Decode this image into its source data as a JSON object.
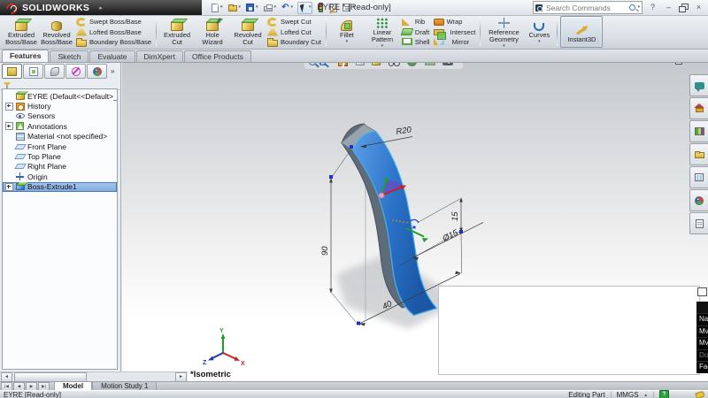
{
  "window": {
    "brand": "SOLIDWORKS",
    "title": "EYRE * [Read-only]",
    "search_placeholder": "Search Commands"
  },
  "glyphs": {
    "caret": "▾",
    "chevrons": "»",
    "minimize": "–",
    "close": "×",
    "help": "?",
    "undo": "↶",
    "overflow": "▸",
    "scroll_left": "◄",
    "scroll_right": "►",
    "nav_first": "|◀",
    "nav_prev": "◀",
    "nav_next": "▶",
    "nav_last": "▶|",
    "up_caret": "▲"
  },
  "quick_access_icons": [
    "new",
    "open",
    "save",
    "print",
    "undo",
    "select",
    "rebuild",
    "file-properties",
    "options"
  ],
  "command_tabs": {
    "active": "Features",
    "items": [
      "Features",
      "Sketch",
      "Evaluate",
      "DimXpert",
      "Office Products"
    ]
  },
  "ribbon": {
    "groups": [
      {
        "big": [
          {
            "label": "Extruded\nBoss/Base"
          },
          {
            "label": "Revolved\nBoss/Base"
          }
        ],
        "small": [
          {
            "label": "Swept Boss/Base"
          },
          {
            "label": "Lofted Boss/Base"
          },
          {
            "label": "Boundary Boss/Base"
          }
        ]
      },
      {
        "big": [
          {
            "label": "Extruded\nCut"
          },
          {
            "label": "Hole\nWizard"
          },
          {
            "label": "Revolved\nCut"
          }
        ],
        "small": [
          {
            "label": "Swept Cut"
          },
          {
            "label": "Lofted Cut"
          },
          {
            "label": "Boundary Cut"
          }
        ]
      },
      {
        "big": [
          {
            "label": "Fillet"
          },
          {
            "label": "Linear\nPattern"
          }
        ],
        "small": [
          {
            "label": "Rib"
          },
          {
            "label": "Draft"
          },
          {
            "label": "Shell"
          }
        ],
        "small2": [
          {
            "label": "Wrap"
          },
          {
            "label": "Intersect"
          },
          {
            "label": "Mirror"
          }
        ]
      },
      {
        "big": [
          {
            "label": "Reference\nGeometry"
          },
          {
            "label": "Curves"
          }
        ]
      },
      {
        "big": [
          {
            "label": "Instant3D"
          }
        ]
      }
    ]
  },
  "feature_tree": {
    "items": [
      {
        "label": "EYRE (Default<<Default>_Displ",
        "icon": "part"
      },
      {
        "label": "History",
        "icon": "history-folder"
      },
      {
        "label": "Sensors",
        "icon": "sensors"
      },
      {
        "label": "Annotations",
        "icon": "annotations"
      },
      {
        "label": "Material <not specified>",
        "icon": "material"
      },
      {
        "label": "Front Plane",
        "icon": "plane"
      },
      {
        "label": "Top Plane",
        "icon": "plane"
      },
      {
        "label": "Right Plane",
        "icon": "plane"
      },
      {
        "label": "Origin",
        "icon": "origin"
      },
      {
        "label": "Boss-Extrude1",
        "icon": "boss-extrude"
      }
    ]
  },
  "headsup_icons": [
    "zoom-to-fit",
    "zoom-to-area",
    "previous-view",
    "section-view",
    "display-style",
    "view-orientation",
    "hide-show-items",
    "appearances",
    "scene",
    "camera"
  ],
  "task_pane_icons": [
    "solidworks-resources",
    "home",
    "design-library",
    "file-explorer",
    "view-palette",
    "appearances",
    "custom-properties"
  ],
  "viewport": {
    "view_label": "*Isometric",
    "dimensions": {
      "radius": "R20",
      "height": "90",
      "width": "40",
      "offset": "15",
      "diameter": "Ø15"
    },
    "triad": {
      "x": "X",
      "y": "Y",
      "z": "Z"
    },
    "colors": {
      "part_face": "#2e7bd0",
      "part_edge": "#46b0ea",
      "background_top": "#c5c8cc"
    }
  },
  "overlay_menu": {
    "items": [
      {
        "label": "Na",
        "disabled": false
      },
      {
        "label": "Mv",
        "disabled": false
      },
      {
        "label": "Mv",
        "disabled": false
      },
      {
        "label": "Do",
        "disabled": true
      },
      {
        "label": "Fac",
        "disabled": false
      }
    ]
  },
  "sheet_tabs": {
    "model": "Model",
    "motion_study": "Motion Study 1"
  },
  "status_bar": {
    "document": "EYRE [Read-only]",
    "mode": "Editing Part",
    "units": "MMGS"
  }
}
